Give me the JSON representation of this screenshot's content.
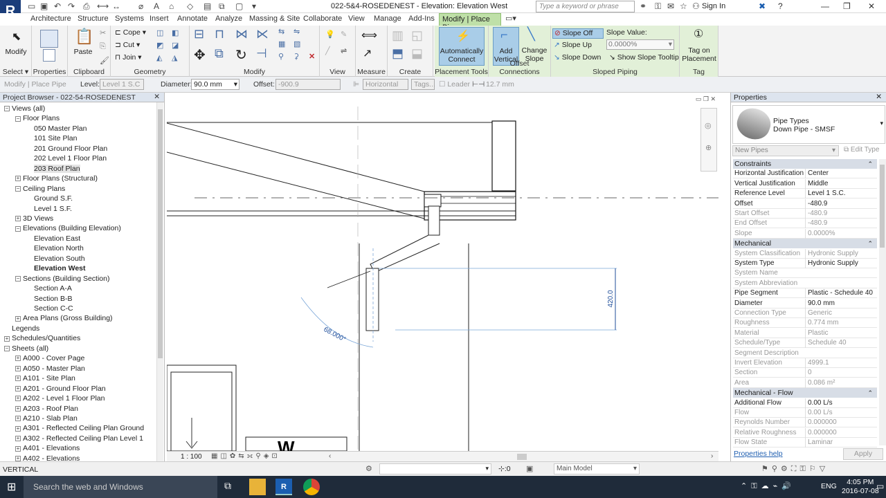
{
  "app": {
    "logo": "R",
    "doc_title": "022-5&4-ROSEDENEST - Elevation: Elevation West"
  },
  "titlebar": {
    "search_placeholder": "Type a keyword or phrase",
    "signin": "Sign In"
  },
  "tabs": [
    "Architecture",
    "Structure",
    "Systems",
    "Insert",
    "Annotate",
    "Analyze",
    "Massing & Site",
    "Collaborate",
    "View",
    "Manage",
    "Add-Ins"
  ],
  "active_tab": "Modify | Place Pipe",
  "ribbon": {
    "modify": "Modify",
    "paste": "Paste",
    "cope": "Cope",
    "cut": "Cut",
    "join": "Join",
    "auto_connect": "Automatically Connect",
    "add_vertical": "Add Vertical",
    "change_slope": "Change Slope",
    "slope_off": "Slope Off",
    "slope_up": "Slope Up",
    "slope_down": "Slope Down",
    "slope_value_label": "Slope Value:",
    "slope_value": "0.0000%",
    "show_slope_tooltip": "Show Slope Tooltip",
    "tag_on_placement": "Tag on Placement",
    "panels": {
      "select": "Select",
      "properties": "Properties",
      "clipboard": "Clipboard",
      "geometry": "Geometry",
      "modify": "Modify",
      "view": "View",
      "measure": "Measure",
      "create": "Create",
      "placement_tools": "Placement Tools",
      "offset_connections": "Offset Connections",
      "sloped_piping": "Sloped Piping",
      "tag": "Tag"
    }
  },
  "options_bar": {
    "context": "Modify | Place Pipe",
    "level_label": "Level:",
    "level_value": "Level 1 S.C",
    "diameter_label": "Diameter:",
    "diameter_value": "90.0 mm",
    "offset_label": "Offset:",
    "offset_value": "-900.9",
    "justification": "Horizontal",
    "tags": "Tags...",
    "leader": "Leader",
    "leader_length": "12.7 mm"
  },
  "browser": {
    "title": "Project Browser - 022-54-ROSEDENEST",
    "items": [
      {
        "label": "Views (all)",
        "toggle": "−"
      },
      {
        "label": "Floor Plans",
        "toggle": "−"
      },
      {
        "label": "050 Master Plan",
        "toggle": ""
      },
      {
        "label": "101 Site Plan",
        "toggle": ""
      },
      {
        "label": "201 Ground Floor Plan",
        "toggle": ""
      },
      {
        "label": "202 Level 1 Floor Plan",
        "toggle": ""
      },
      {
        "label": "203 Roof Plan",
        "toggle": ""
      },
      {
        "label": "Floor Plans (Structural)",
        "toggle": "+"
      },
      {
        "label": "Ceiling Plans",
        "toggle": "−"
      },
      {
        "label": "Ground S.F.",
        "toggle": ""
      },
      {
        "label": "Level 1 S.F.",
        "toggle": ""
      },
      {
        "label": "3D Views",
        "toggle": "+"
      },
      {
        "label": "Elevations (Building Elevation)",
        "toggle": "−"
      },
      {
        "label": "Elevation East",
        "toggle": ""
      },
      {
        "label": "Elevation North",
        "toggle": ""
      },
      {
        "label": "Elevation South",
        "toggle": ""
      },
      {
        "label": "Elevation West",
        "toggle": ""
      },
      {
        "label": "Sections (Building Section)",
        "toggle": "−"
      },
      {
        "label": "Section A-A",
        "toggle": ""
      },
      {
        "label": "Section B-B",
        "toggle": ""
      },
      {
        "label": "Section C-C",
        "toggle": ""
      },
      {
        "label": "Area Plans (Gross Building)",
        "toggle": "+"
      },
      {
        "label": "Legends",
        "toggle": ""
      },
      {
        "label": "Schedules/Quantities",
        "toggle": "+"
      },
      {
        "label": "Sheets (all)",
        "toggle": "−"
      },
      {
        "label": "A000 - Cover Page",
        "toggle": "+"
      },
      {
        "label": "A050 - Master Plan",
        "toggle": "+"
      },
      {
        "label": "A101 - Site Plan",
        "toggle": "+"
      },
      {
        "label": "A201 - Ground Floor Plan",
        "toggle": "+"
      },
      {
        "label": "A202 - Level 1 Floor Plan",
        "toggle": "+"
      },
      {
        "label": "A203 - Roof Plan",
        "toggle": "+"
      },
      {
        "label": "A210 - Slab Plan",
        "toggle": "+"
      },
      {
        "label": "A301 - Reflected Ceiling Plan Ground",
        "toggle": "+"
      },
      {
        "label": "A302 - Reflected Ceiling Plan Level 1",
        "toggle": "+"
      },
      {
        "label": "A401 - Elevations",
        "toggle": "+"
      },
      {
        "label": "A402 - Elevations",
        "toggle": "+"
      }
    ]
  },
  "canvas": {
    "dim_vertical": "420.0",
    "angle": "68.000°",
    "scale": "1 : 100"
  },
  "properties": {
    "title": "Properties",
    "type_name": "Pipe Types",
    "type_sub": "Down Pipe - SMSF",
    "new_label": "New Pipes",
    "edit_type": "Edit Type",
    "help": "Properties help",
    "apply": "Apply",
    "sections": [
      {
        "name": "Constraints",
        "rows": [
          {
            "k": "Horizontal Justification",
            "v": "Center",
            "dim": false
          },
          {
            "k": "Vertical Justification",
            "v": "Middle",
            "dim": false
          },
          {
            "k": "Reference Level",
            "v": "Level 1 S.C.",
            "dim": false
          },
          {
            "k": "Offset",
            "v": "-480.9",
            "dim": false
          },
          {
            "k": "Start Offset",
            "v": "-480.9",
            "dim": true
          },
          {
            "k": "End Offset",
            "v": "-480.9",
            "dim": true
          },
          {
            "k": "Slope",
            "v": "0.0000%",
            "dim": true
          }
        ]
      },
      {
        "name": "Mechanical",
        "rows": [
          {
            "k": "System Classification",
            "v": "Hydronic Supply",
            "dim": true
          },
          {
            "k": "System Type",
            "v": "Hydronic Supply",
            "dim": false
          },
          {
            "k": "System Name",
            "v": "",
            "dim": true
          },
          {
            "k": "System Abbreviation",
            "v": "",
            "dim": true
          },
          {
            "k": "Pipe Segment",
            "v": "Plastic - Schedule 40",
            "dim": false
          },
          {
            "k": "Diameter",
            "v": "90.0 mm",
            "dim": false
          },
          {
            "k": "Connection Type",
            "v": "Generic",
            "dim": true
          },
          {
            "k": "Roughness",
            "v": "0.774 mm",
            "dim": true
          },
          {
            "k": "Material",
            "v": "Plastic",
            "dim": true
          },
          {
            "k": "Schedule/Type",
            "v": "Schedule 40",
            "dim": true
          },
          {
            "k": "Segment Description",
            "v": "",
            "dim": true
          },
          {
            "k": "Invert Elevation",
            "v": "4999.1",
            "dim": true
          },
          {
            "k": "Section",
            "v": "0",
            "dim": true
          },
          {
            "k": "Area",
            "v": "0.086 m²",
            "dim": true
          }
        ]
      },
      {
        "name": "Mechanical - Flow",
        "rows": [
          {
            "k": "Additional Flow",
            "v": "0.00 L/s",
            "dim": false
          },
          {
            "k": "Flow",
            "v": "0.00 L/s",
            "dim": true
          },
          {
            "k": "Reynolds Number",
            "v": "0.000000",
            "dim": true
          },
          {
            "k": "Relative Roughness",
            "v": "0.000000",
            "dim": true
          },
          {
            "k": "Flow State",
            "v": "Laminar",
            "dim": true
          }
        ]
      }
    ]
  },
  "status": {
    "mode": "VERTICAL",
    "zoom": ":0",
    "model": "Main Model"
  },
  "taskbar": {
    "search": "Search the web and Windows",
    "time": "4:05 PM",
    "date": "2016-07-08",
    "lang": "ENG"
  }
}
